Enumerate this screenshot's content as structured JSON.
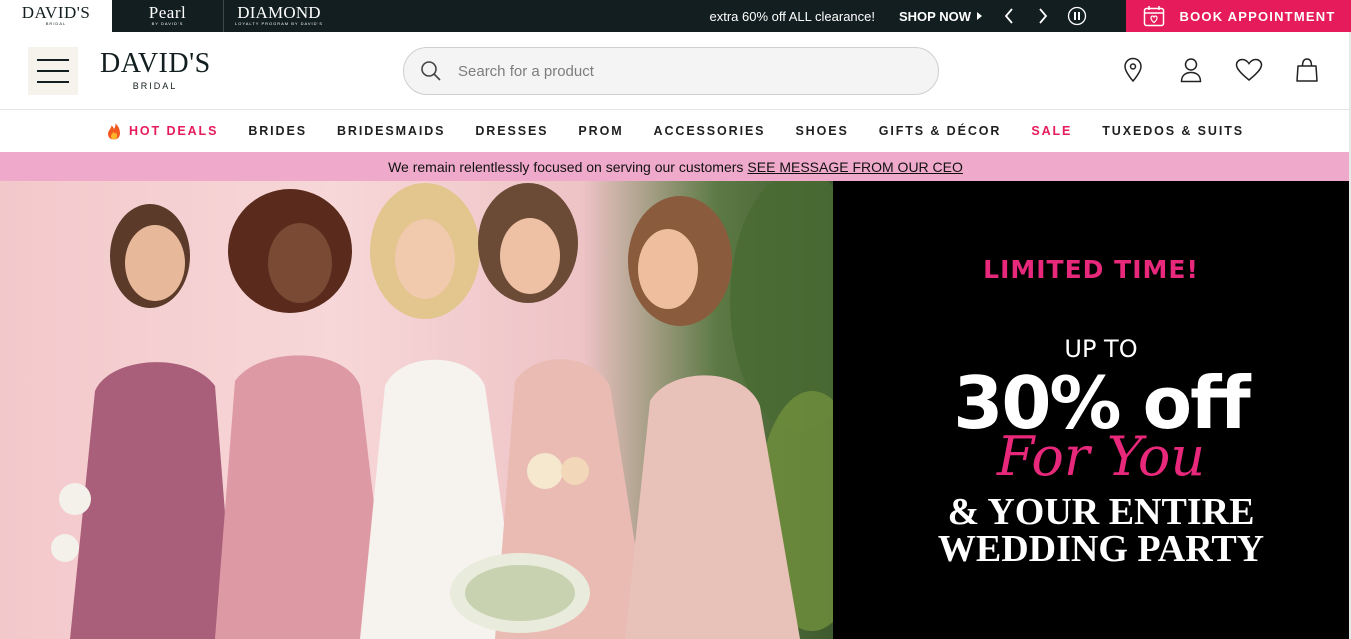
{
  "topbar": {
    "brands": [
      {
        "name": "DAVID'S",
        "sub": "BRIDAL"
      },
      {
        "name": "Pearl",
        "sub": "BY DAVID'S"
      },
      {
        "name": "DIAMOND",
        "sub": "LOYALTY PROGRAM BY DAVID'S"
      }
    ],
    "promo_text": "extra 60% off ALL clearance!",
    "promo_link": "SHOP NOW",
    "book_button": "BOOK APPOINTMENT"
  },
  "header": {
    "logo_name": "DAVID'S",
    "logo_sub": "BRIDAL",
    "search_placeholder": "Search for a product"
  },
  "nav": {
    "items": [
      {
        "label": "HOT DEALS"
      },
      {
        "label": "BRIDES"
      },
      {
        "label": "BRIDESMAIDS"
      },
      {
        "label": "DRESSES"
      },
      {
        "label": "PROM"
      },
      {
        "label": "ACCESSORIES"
      },
      {
        "label": "SHOES"
      },
      {
        "label": "GIFTS & DÉCOR"
      },
      {
        "label": "SALE"
      },
      {
        "label": "TUXEDOS & SUITS"
      }
    ]
  },
  "banner": {
    "text": "We remain relentlessly focused on serving our customers",
    "link": "SEE MESSAGE FROM OUR CEO"
  },
  "hero": {
    "limited": "LIMITED TIME!",
    "upto": "UP TO",
    "percent": "30% off",
    "for_you": "For You",
    "line1": "& YOUR ENTIRE",
    "line2": "WEDDING PARTY"
  },
  "colors": {
    "brand_pink": "#e51b5b",
    "topbar_bg": "#121e1f",
    "banner_pink": "#efaacb"
  }
}
